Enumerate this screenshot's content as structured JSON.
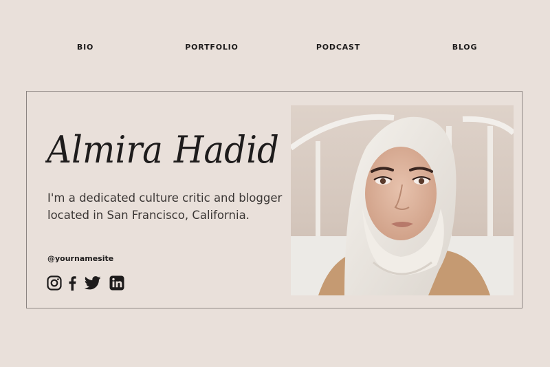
{
  "nav": {
    "items": [
      {
        "label": "BIO"
      },
      {
        "label": "PORTFOLIO"
      },
      {
        "label": "PODCAST"
      },
      {
        "label": "BLOG"
      }
    ]
  },
  "profile": {
    "name": "Almira Hadid",
    "bio": "I'm a dedicated culture critic and blogger located in San Francisco, California.",
    "handle": "@yournamesite"
  },
  "socials": [
    {
      "icon": "instagram-icon"
    },
    {
      "icon": "facebook-icon"
    },
    {
      "icon": "twitter-icon"
    },
    {
      "icon": "linkedin-icon"
    }
  ],
  "colors": {
    "background": "#e9e0da",
    "text": "#1e1c1c",
    "border": "#8c8582"
  }
}
